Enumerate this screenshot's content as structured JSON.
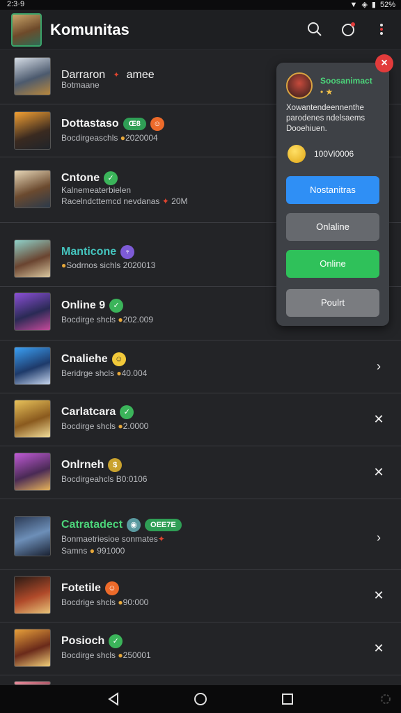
{
  "status": {
    "time": "2:3·9",
    "battery": "52%"
  },
  "header": {
    "title": "Komunitas"
  },
  "list": [
    {
      "name": "Darraron",
      "name_extra": "amee",
      "sub": "Botmaane",
      "sub2": ""
    },
    {
      "name": "Dottastaso",
      "pill": "Œ8",
      "sub": "Bocdirgeaschls",
      "stat": "2020004"
    },
    {
      "name": "Cntone",
      "sub": "Kalnemeaterbielen",
      "sub2": "Racelndcttemcd nevdanas",
      "stat": "20M"
    },
    {
      "name": "Manticone",
      "sub": "Sodrnos sichls",
      "stat": "2020013"
    },
    {
      "name": "Online 9",
      "sub": "Bocdirge shcls",
      "stat": "202.009"
    },
    {
      "name": "Cnaliehe",
      "sub": "Beridrge shcls",
      "stat": "40.004"
    },
    {
      "name": "Carlatcara",
      "sub": "Bocdirge shcls",
      "stat": "2.0000"
    },
    {
      "name": "Onlrneh",
      "sub": "Bocdirgeahcls",
      "stat": "B0:0106"
    },
    {
      "name": "Catratadect",
      "pill": "OEE7E",
      "sub": "Bonmaetriesioe sonmates",
      "sub2": "Samns",
      "stat": "991000"
    },
    {
      "name": "Fotetile",
      "sub": "Bocdrige shcls",
      "stat": "90:000"
    },
    {
      "name": "Posioch",
      "sub": "Bocdirge shcls",
      "stat": "250001"
    }
  ],
  "popover": {
    "name": "Soosanimact",
    "rank": "• ★",
    "desc": "Xowantendeennenthe parodenes ndelsaems Dooehiuen.",
    "coins": "100Vi0006",
    "buttons": [
      "Nostanitras",
      "Onlaline",
      "Online",
      "Poulrt"
    ]
  },
  "colors": {
    "accent_blue": "#2f8ff5",
    "accent_green": "#2fc15a",
    "close_red": "#e23b3b"
  },
  "icons": [
    "search-icon",
    "notification-icon",
    "more-icon",
    "back-icon",
    "home-icon",
    "recents-icon"
  ]
}
